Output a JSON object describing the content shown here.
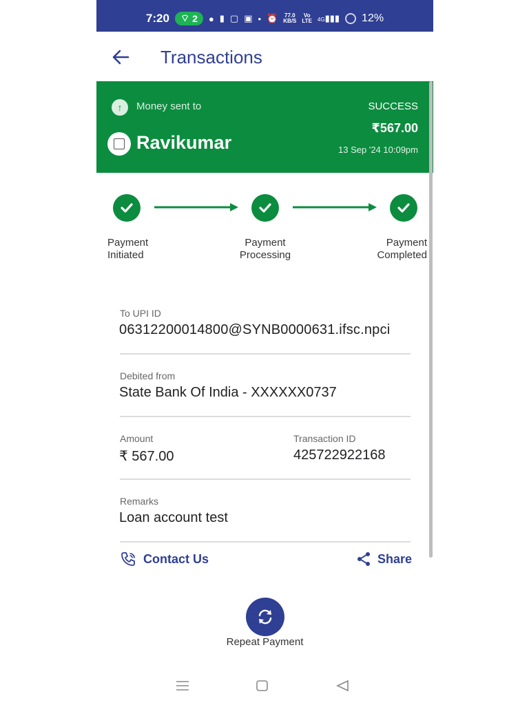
{
  "status_bar": {
    "time": "7:20",
    "hotspot_count": "2",
    "speed_value": "77.0",
    "speed_unit": "KB/S",
    "network_top": "Vo",
    "network_bottom": "LTE",
    "network_gen": "4G",
    "battery": "12%"
  },
  "header": {
    "title": "Transactions"
  },
  "banner": {
    "caption": "Money sent to",
    "status": "SUCCESS",
    "payee": "Ravikumar",
    "amount": "₹567.00",
    "datetime": "13 Sep '24 10:09pm",
    "color": "#0c8c3f"
  },
  "steps": [
    {
      "line1": "Payment",
      "line2": "Initiated"
    },
    {
      "line1": "Payment",
      "line2": "Processing"
    },
    {
      "line1": "Payment",
      "line2": "Completed"
    }
  ],
  "details": {
    "upi_label": "To UPI ID",
    "upi_value": "06312200014800@SYNB0000631.ifsc.npci",
    "debited_label": "Debited from",
    "debited_value": "State Bank Of India - XXXXXX0737",
    "amount_label": "Amount",
    "amount_value": "₹ 567.00",
    "txn_label": "Transaction ID",
    "txn_value": "425722922168",
    "remarks_label": "Remarks",
    "remarks_value": "Loan account test"
  },
  "actions": {
    "contact": "Contact Us",
    "share": "Share",
    "repeat": "Repeat Payment"
  },
  "colors": {
    "primary": "#2f3f93",
    "success": "#0c8c3f"
  }
}
